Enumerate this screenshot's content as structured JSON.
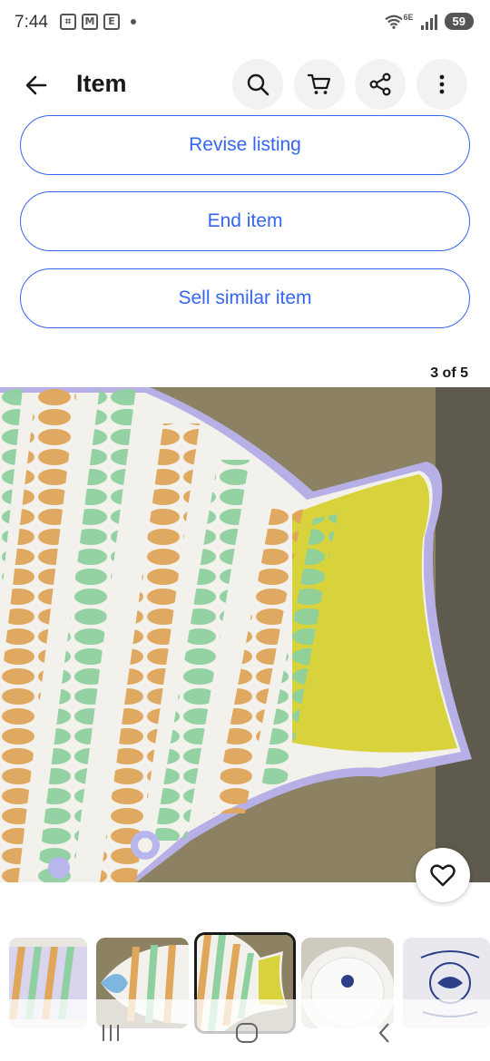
{
  "status": {
    "time": "7:44",
    "battery": "59",
    "network": "6E",
    "left_icons": [
      "screenshot-icon",
      "gmail-icon",
      "ebay-icon",
      "dot"
    ]
  },
  "header": {
    "title": "Item",
    "icons": [
      "back-arrow-icon",
      "search-icon",
      "cart-icon",
      "share-icon",
      "more-vertical-icon"
    ]
  },
  "actions": {
    "revise": "Revise listing",
    "end": "End item",
    "sell_similar": "Sell similar item"
  },
  "gallery": {
    "counter": "3 of 5",
    "current_index": 3,
    "total": 5
  },
  "thumbnails": {
    "items": [
      "photo-1",
      "photo-2",
      "photo-3",
      "photo-4",
      "photo-5"
    ]
  },
  "colors": {
    "accent": "#3665f3",
    "text": "#191919"
  }
}
